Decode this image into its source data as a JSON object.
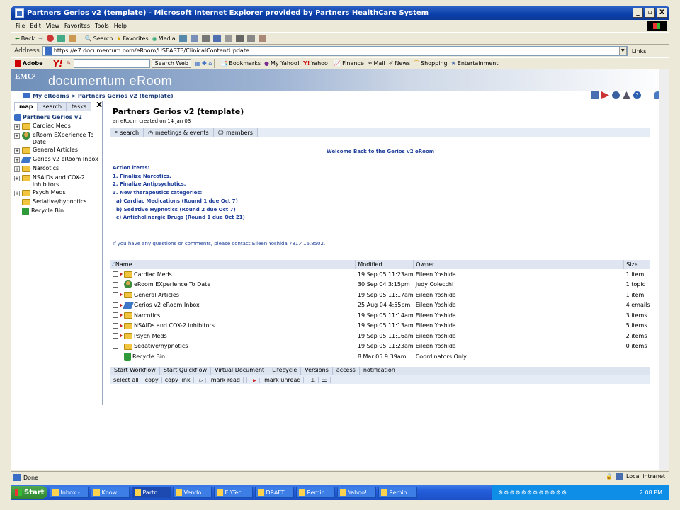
{
  "window": {
    "title": "Partners Gerios v2 (template) - Microsoft Internet Explorer provided by Partners HealthCare System",
    "buttons": [
      "_",
      "▫",
      "X"
    ]
  },
  "menu": [
    "File",
    "Edit",
    "View",
    "Favorites",
    "Tools",
    "Help"
  ],
  "toolbar": {
    "back": "Back",
    "search": "Search",
    "favorites": "Favorites",
    "media": "Media"
  },
  "address": {
    "label": "Address",
    "url": "https://e7.documentum.com/eRoom/USEAST3/ClinicalContentUpdate",
    "links": "Links"
  },
  "yahoo": {
    "adobe": "Adobe",
    "logo": "Y!",
    "search_web": "Search Web",
    "items": [
      "Bookmarks",
      "My Yahoo!",
      "Yahoo!",
      "Finance",
      "Mail",
      "News",
      "Shopping",
      "Entertainment"
    ]
  },
  "eroom": {
    "emc": "EMC²",
    "brand": "documentum eRoom",
    "breadcrumb": "My eRooms > Partners Gerios v2 (template)"
  },
  "nav": {
    "tabs": [
      "map",
      "search",
      "tasks"
    ],
    "close": "X",
    "root": "Partners Gerios v2",
    "items": [
      {
        "label": "Cardiac Meds",
        "icon": "folder",
        "expand": true
      },
      {
        "label": "eRoom EXperience To Date",
        "icon": "person",
        "expand": true
      },
      {
        "label": "General Articles",
        "icon": "folder",
        "expand": true
      },
      {
        "label": "Gerios v2 eRoom Inbox",
        "icon": "inbox",
        "expand": true
      },
      {
        "label": "Narcotics",
        "icon": "folder",
        "expand": true
      },
      {
        "label": "NSAIDs and COX-2 inhibitors",
        "icon": "folder",
        "expand": true
      },
      {
        "label": "Psych Meds",
        "icon": "folder",
        "expand": true
      },
      {
        "label": "Sedative/hypnotics",
        "icon": "folder",
        "expand": false
      },
      {
        "label": "Recycle Bin",
        "icon": "recycle",
        "expand": false
      }
    ]
  },
  "room": {
    "title": "Partners Gerios v2 (template)",
    "subtitle": "an eRoom created on 14 Jan 03",
    "tabs": [
      "search",
      "meetings & events",
      "members"
    ],
    "welcome": "Welcome Back to the Gerios v2 eRoom",
    "actions": [
      "Action items:",
      "1. Finalize Narcotics.",
      "2. Finalize Antipsychotics.",
      "3. New therapeutics categories:",
      "a) Cardiac Medications (Round 1 due Oct 7)",
      "b) Sedative Hypnotics (Round 2 due Oct 7)",
      "c) Anticholinergic Drugs (Round 1 due Oct 21)"
    ],
    "contact": "If you have any questions or comments, please contact Eileen Yoshida 781.416.8502."
  },
  "table": {
    "headers": [
      "Name",
      "Modified",
      "Owner",
      "Size"
    ],
    "rows": [
      {
        "name": "Cardiac Meds",
        "icon": "folder",
        "tri": true,
        "modified": "19 Sep 05  11:23am",
        "owner": "Eileen Yoshida",
        "size": "1 item"
      },
      {
        "name": "eRoom EXperience To Date",
        "icon": "person",
        "tri": false,
        "modified": "30 Sep 04  3:15pm",
        "owner": "Judy Colecchi",
        "size": "1 topic"
      },
      {
        "name": "General Articles",
        "icon": "folder",
        "tri": true,
        "modified": "19 Sep 05  11:17am",
        "owner": "Eileen Yoshida",
        "size": "1 item"
      },
      {
        "name": "Gerios v2 eRoom Inbox",
        "icon": "inbox",
        "tri": true,
        "modified": "25 Aug 04  4:55pm",
        "owner": "Eileen Yoshida",
        "size": "4 emails"
      },
      {
        "name": "Narcotics",
        "icon": "folder",
        "tri": true,
        "modified": "19 Sep 05  11:14am",
        "owner": "Eileen Yoshida",
        "size": "3 items"
      },
      {
        "name": "NSAIDs and COX-2 inhibitors",
        "icon": "folder",
        "tri": true,
        "modified": "19 Sep 05  11:13am",
        "owner": "Eileen Yoshida",
        "size": "5 items"
      },
      {
        "name": "Psych Meds",
        "icon": "folder",
        "tri": true,
        "modified": "19 Sep 05  11:16am",
        "owner": "Eileen Yoshida",
        "size": "2 items"
      },
      {
        "name": "Sedative/hypnotics",
        "icon": "folder",
        "tri": false,
        "modified": "19 Sep 05  11:23am",
        "owner": "Eileen Yoshida",
        "size": "0 items"
      },
      {
        "name": "Recycle Bin",
        "icon": "recycle",
        "tri": false,
        "modified": "8 Mar 05  9:39am",
        "owner": "Coordinators Only",
        "size": ""
      }
    ]
  },
  "commands1": [
    "Start Workflow",
    "Start Quickflow",
    "Virtual Document",
    "Lifecycle",
    "Versions",
    "access",
    "notification"
  ],
  "commands2": [
    "select all",
    "copy",
    "copy link",
    "mark read",
    "mark unread"
  ],
  "status": {
    "text": "Done",
    "zone": "Local intranet"
  },
  "taskbar": {
    "start": "Start",
    "tasks": [
      "Inbox -...",
      "Knowl...",
      "Partn...",
      "Vendo...",
      "E:\\Tec...",
      "DRAFT...",
      "Remin...",
      "Yahoo!...",
      "Remin..."
    ],
    "active_index": 2,
    "time": "2:08 PM"
  },
  "colors": {
    "titlebar": "#0a3fa8",
    "link_blue": "#1f3f9a",
    "folder": "#f1c540",
    "taskbar": "#245edb"
  }
}
